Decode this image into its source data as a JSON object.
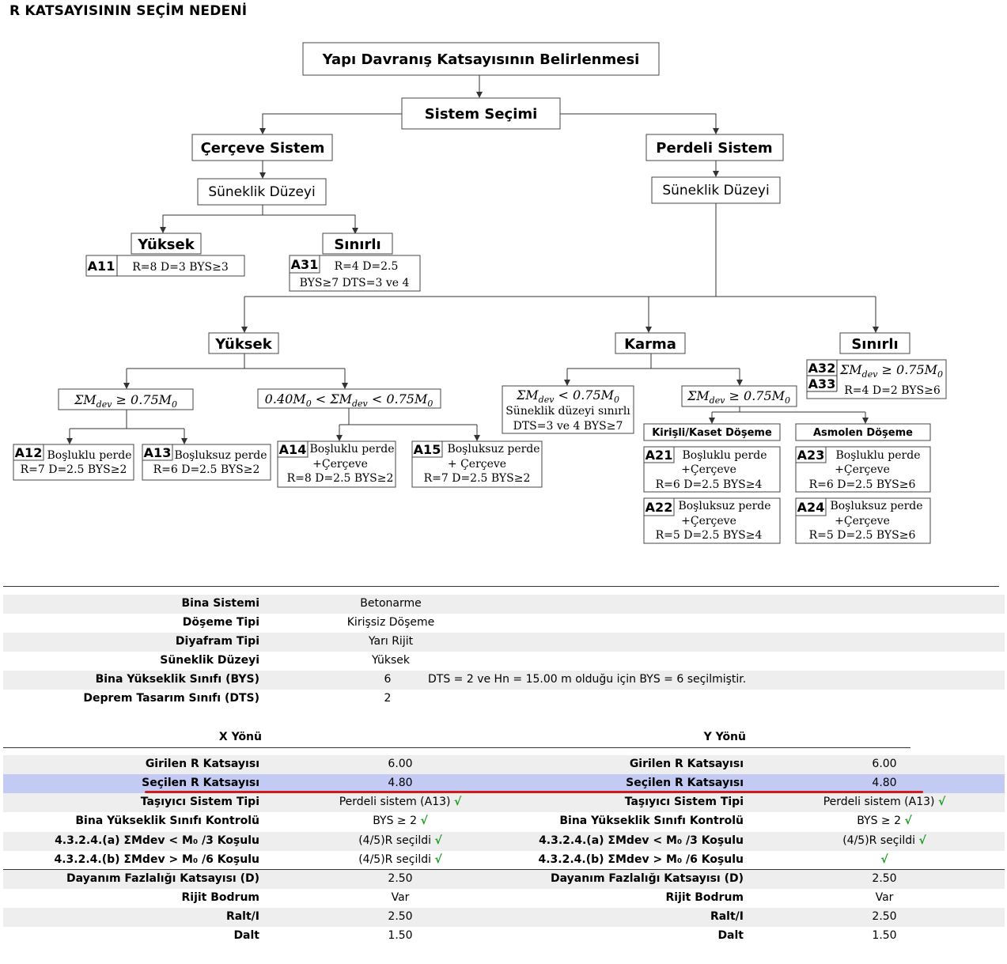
{
  "page_title": "R KATSAYISININ SEÇİM NEDENİ",
  "flowchart": {
    "root": "Yapı Davranış Katsayısının Belirlenmesi",
    "system_choice": "Sistem Seçimi",
    "frame_system": "Çerçeve Sistem",
    "wall_system": "Perdeli Sistem",
    "ductility": "Süneklik Düzeyi",
    "high": "Yüksek",
    "limited": "Sınırlı",
    "mixed": "Karma",
    "m_lt": "ΣM",
    "sub_dev": "dev",
    "ge_075": "≥ 0.75M",
    "lt_075": "< 0.75M",
    "sub0": "0",
    "mid_left": "0.40M",
    "mid_lt": "< ΣM",
    "ductility_limited_note": "Süneklik düzeyi sınırlı",
    "dts_bys_note": "DTS=3 ve 4 BYS≥7",
    "ribbed": "Kirişli/Kaset Döşeme",
    "joist": "Asmolen Döşeme",
    "codes": {
      "A11": "A11",
      "A31": "A31",
      "A12": "A12",
      "A13": "A13",
      "A14": "A14",
      "A15": "A15",
      "A21": "A21",
      "A22": "A22",
      "A23": "A23",
      "A24": "A24",
      "A32": "A32",
      "A33": "A33"
    },
    "texts": {
      "a11": "R=8 D=3 BYS≥3",
      "a31_1": "R=4 D=2.5",
      "a31_2": "BYS≥7 DTS=3 ve 4",
      "a32": "R=4 D=2 BYS≥6",
      "a12_1": "Boşluklu perde",
      "a12_2": "R=7 D=2.5 BYS≥2",
      "a13_1": "Boşluksuz perde",
      "a13_2": "R=6 D=2.5 BYS≥2",
      "a14_1": "Boşluklu perde",
      "a14_2": "+Çerçeve",
      "a14_3": "R=8 D=2.5 BYS≥2",
      "a15_1": "Boşluksuz perde",
      "a15_2": "+ Çerçeve",
      "a15_3": "R=7 D=2.5 BYS≥2",
      "a21_1": "Boşluklu perde",
      "a21_2": "+Çerçeve",
      "a21_3": "R=6 D=2.5 BYS≥4",
      "a22_1": "Boşluksuz perde",
      "a22_2": "+Çerçeve",
      "a22_3": "R=5 D=2.5 BYS≥4",
      "a23_1": "Boşluklu perde",
      "a23_2": "+Çerçeve",
      "a23_3": "R=6 D=2.5 BYS≥6",
      "a24_1": "Boşluksuz perde",
      "a24_2": "+Çerçeve",
      "a24_3": "R=5 D=2.5 BYS≥6"
    }
  },
  "building_info": [
    {
      "label": "Bina Sistemi",
      "value": "Betonarme"
    },
    {
      "label": "Döşeme Tipi",
      "value": "Kirişsiz Döşeme"
    },
    {
      "label": "Diyafram Tipi",
      "value": "Yarı Rijit"
    },
    {
      "label": "Süneklik Düzeyi",
      "value": "Yüksek"
    },
    {
      "label": "Bina Yükseklik Sınıfı (BYS)",
      "value": "6",
      "note": "DTS = 2 ve Hn = 15.00 m olduğu için  BYS = 6 seçilmiştir."
    },
    {
      "label": "Deprem Tasarım Sınıfı (DTS)",
      "value": "2"
    }
  ],
  "direction_headers": {
    "x": "X Yönü",
    "y": "Y Yönü"
  },
  "direction_rows": [
    {
      "label": "Girilen R Katsayısı",
      "x": "6.00",
      "y": "6.00"
    },
    {
      "label": "Seçilen R Katsayısı",
      "x": "4.80",
      "y": "4.80"
    },
    {
      "label": "Taşıyıcı Sistem Tipi",
      "x": "Perdeli sistem (A13)",
      "y": "Perdeli sistem (A13)",
      "x_check": "√",
      "y_check": "√"
    },
    {
      "label": "Bina Yükseklik Sınıfı Kontrolü",
      "x": "BYS ≥ 2",
      "y": "BYS ≥ 2",
      "x_check": "√",
      "y_check": "√"
    },
    {
      "label": "4.3.2.4.(a) ΣMdev < M₀ /3 Koşulu",
      "x": "(4/5)R seçildi",
      "y": "(4/5)R seçildi",
      "x_check": "√",
      "y_check": "√"
    },
    {
      "label": "4.3.2.4.(b) ΣMdev > M₀ /6 Koşulu",
      "x": "(4/5)R seçildi",
      "y": "",
      "x_check": "√",
      "y_check": "√"
    },
    {
      "label": "Dayanım Fazlalığı Katsayısı (D)",
      "x": "2.50",
      "y": "2.50"
    },
    {
      "label": "Rijit Bodrum",
      "x": "Var",
      "y": "Var"
    },
    {
      "label": "Ralt/I",
      "x": "2.50",
      "y": "2.50"
    },
    {
      "label": "Dalt",
      "x": "1.50",
      "y": "1.50"
    }
  ]
}
